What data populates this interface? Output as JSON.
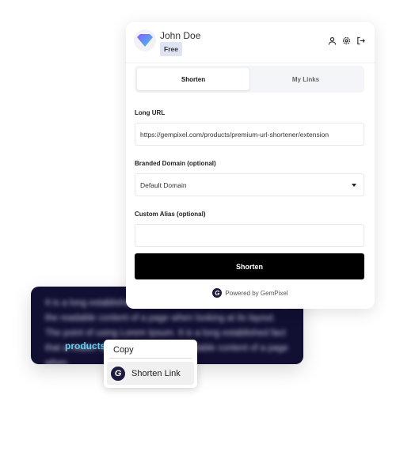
{
  "background_text": {
    "blurred": "It is a long established fact that a reader will be distracted by the readable content of a page when looking at its layout. The point of using Lorem Ipsum. It is a long established fact that a reader will be products the readable content of a page when.",
    "highlight": "products"
  },
  "header": {
    "user_name": "John Doe",
    "plan_badge": "Free",
    "icons": [
      "user-icon",
      "gear-icon",
      "logout-icon"
    ]
  },
  "tabs": [
    {
      "label": "Shorten",
      "active": true
    },
    {
      "label": "My Links",
      "active": false
    }
  ],
  "form": {
    "long_url_label": "Long URL",
    "long_url_value": "https://gempixel.com/products/premium-url-shortener/extension",
    "domain_label": "Branded Domain (optional)",
    "domain_value": "Default Domain",
    "alias_label": "Custom Alias (optional)",
    "alias_value": "",
    "submit_label": "Shorten"
  },
  "footer": {
    "powered_by": "Powered by GemPixel",
    "logo_letter": "G"
  },
  "context_menu": {
    "copy": "Copy",
    "shorten": "Shorten Link"
  },
  "colors": {
    "panel_bg": "#110f32",
    "highlight": "#5fd3ef",
    "button": "#000000"
  }
}
